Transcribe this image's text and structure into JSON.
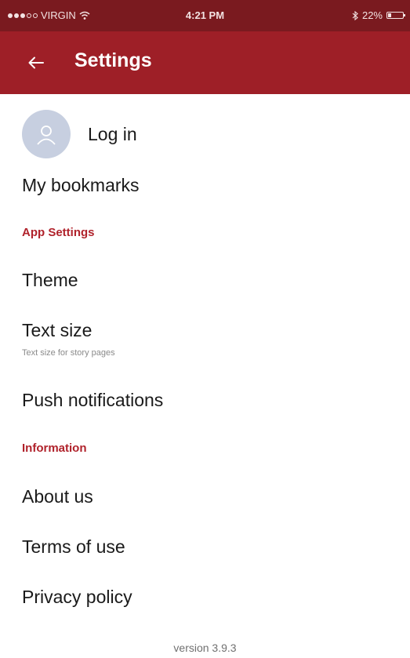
{
  "status_bar": {
    "carrier": "VIRGIN",
    "time": "4:21 PM",
    "battery": "22%",
    "battery_level": 0.22
  },
  "app_bar": {
    "title": "Settings"
  },
  "account": {
    "login_label": "Log in",
    "bookmarks_label": "My bookmarks"
  },
  "app_settings": {
    "header": "App Settings",
    "theme_label": "Theme",
    "text_size_label": "Text size",
    "text_size_sub": "Text size for story pages",
    "push_label": "Push notifications"
  },
  "information": {
    "header": "Information",
    "about_label": "About us",
    "terms_label": "Terms of use",
    "privacy_label": "Privacy policy"
  },
  "footer": {
    "version": "version 3.9.3"
  },
  "colors": {
    "status_bar": "#7a1a1f",
    "app_bar": "#9e1f27",
    "section_header": "#b0222b",
    "avatar_bg": "#c7cfe0"
  }
}
